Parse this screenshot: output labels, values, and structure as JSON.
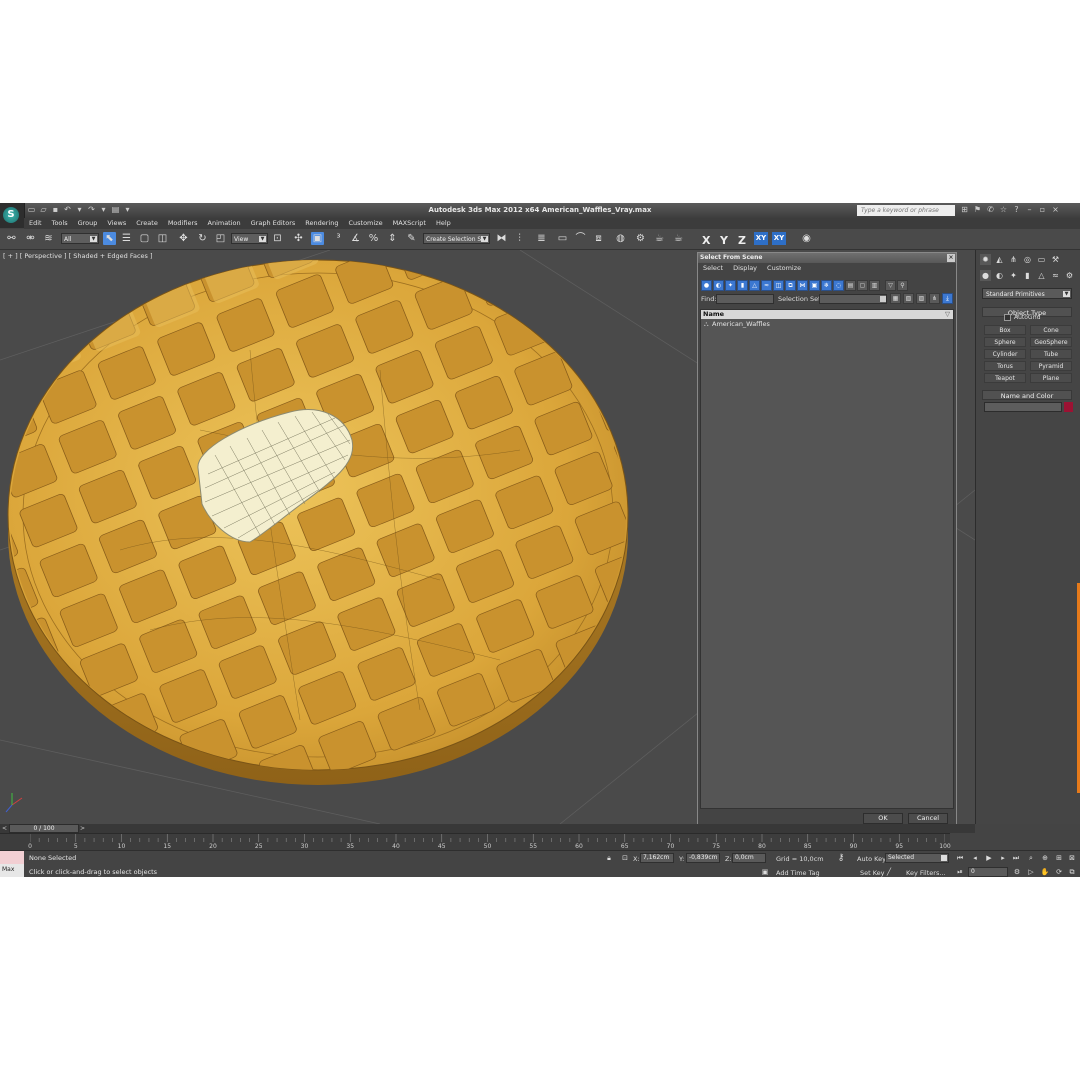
{
  "window": {
    "title": "Autodesk 3ds Max  2012 x64     American_Waffles_Vray.max",
    "help_placeholder": "Type a keyword or phrase"
  },
  "menu": [
    "Edit",
    "Tools",
    "Group",
    "Views",
    "Create",
    "Modifiers",
    "Animation",
    "Graph Editors",
    "Rendering",
    "Customize",
    "MAXScript",
    "Help"
  ],
  "toolbar": {
    "filter_value": "All",
    "ref_coord": "View",
    "selection_set_placeholder": "Create Selection Se",
    "axes": [
      "X",
      "Y",
      "Z",
      "XY",
      "XY"
    ]
  },
  "viewport": {
    "label": "[ + ] [ Perspective ] [ Shaded + Edged Faces ]"
  },
  "dialog": {
    "title": "Select From Scene",
    "menu": [
      "Select",
      "Display",
      "Customize"
    ],
    "find_label": "Find:",
    "selection_set_label": "Selection Set:",
    "column_name": "Name",
    "items": [
      "American_Waffles"
    ],
    "ok": "OK",
    "cancel": "Cancel"
  },
  "command_panel": {
    "category": "Standard Primitives",
    "object_type": "Object Type",
    "autogrid": "AutoGrid",
    "primitives": [
      "Box",
      "Cone",
      "Sphere",
      "GeoSphere",
      "Cylinder",
      "Tube",
      "Torus",
      "Pyramid",
      "Teapot",
      "Plane"
    ],
    "name_and_color": "Name and Color",
    "color": "#9b1233"
  },
  "timeline": {
    "frame": "0 / 100",
    "ticks": [
      "0",
      "5",
      "10",
      "15",
      "20",
      "25",
      "30",
      "35",
      "40",
      "45",
      "50",
      "55",
      "60",
      "65",
      "70",
      "75",
      "80",
      "85",
      "90",
      "95",
      "100"
    ]
  },
  "status": {
    "selection": "None Selected",
    "prompt": "Click or click-and-drag to select objects",
    "x_label": "X:",
    "x": "7,162cm",
    "y_label": "Y:",
    "y": "-0,839cm",
    "z_label": "Z:",
    "z": "0,0cm",
    "grid": "Grid = 10,0cm",
    "add_time_tag": "Add Time Tag",
    "auto_key": "Auto Key",
    "set_key": "Set Key",
    "key_mode": "Selected",
    "key_filters": "Key Filters...",
    "current_frame": "0",
    "maxscript_label": "Max"
  }
}
